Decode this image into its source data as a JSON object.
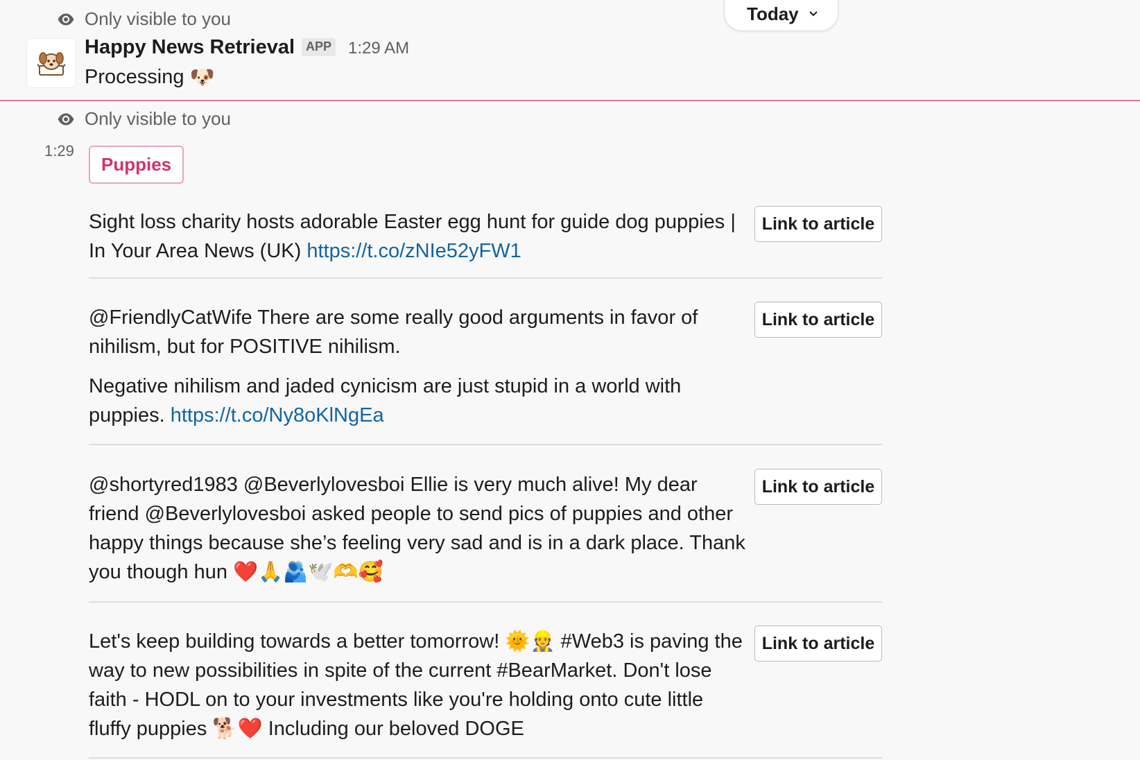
{
  "header_message": {
    "visibility_text": "Only visible to you",
    "sender": "Happy News Retrieval",
    "badge": "APP",
    "time": "1:29 AM",
    "text": "Processing",
    "text_emoji": "🐶"
  },
  "date_divider": {
    "label": "Today"
  },
  "results_message": {
    "visibility_text": "Only visible to you",
    "time": "1:29",
    "tag": "Puppies",
    "articles": [
      {
        "paragraphs": [
          {
            "text": "Sight loss charity hosts adorable Easter egg hunt for guide dog puppies | In Your Area News (UK) ",
            "link": "https://t.co/zNIe52yFW1"
          }
        ],
        "button_label": "Link to article"
      },
      {
        "paragraphs": [
          {
            "text": "@FriendlyCatWife There are some really good arguments in favor of nihilism, but for POSITIVE nihilism.",
            "link": ""
          },
          {
            "text": "Negative nihilism and jaded cynicism are just stupid in a world with puppies. ",
            "link": "https://t.co/Ny8oKlNgEa"
          }
        ],
        "button_label": "Link to article"
      },
      {
        "paragraphs": [
          {
            "text": "@shortyred1983 @Beverlylovesboi Ellie is very much alive! My dear friend @Beverlylovesboi asked people to send pics of puppies and other happy things because she’s feeling very sad and is in a dark place. Thank you though hun ❤️🙏🫂🕊️🫶🥰",
            "link": ""
          }
        ],
        "button_label": "Link to article"
      },
      {
        "paragraphs": [
          {
            "text": "Let's keep building towards a better tomorrow! 🌞👷 #Web3 is paving the way to new possibilities in spite of the current #BearMarket. Don't lose faith - HODL on to your investments like you're holding onto cute little fluffy puppies 🐕❤️ Including our beloved DOGE",
            "link": ""
          }
        ],
        "button_label": "Link to article"
      }
    ]
  }
}
